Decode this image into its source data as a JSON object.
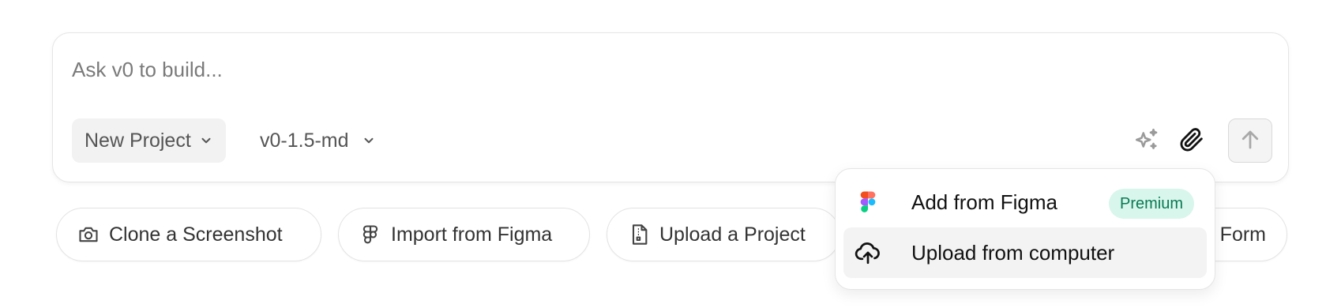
{
  "prompt": {
    "placeholder": "Ask v0 to build...",
    "value": ""
  },
  "toolbar": {
    "project_label": "New Project",
    "model_label": "v0-1.5-md"
  },
  "chips": {
    "clone_label": "Clone a Screenshot",
    "figma_label": "Import from Figma",
    "upload_label": "Upload a Project",
    "form_label": "Form"
  },
  "attach_menu": {
    "items": [
      {
        "label": "Add from Figma",
        "badge": "Premium",
        "icon": "figma-icon"
      },
      {
        "label": "Upload from computer",
        "icon": "cloud-upload-icon"
      }
    ]
  },
  "colors": {
    "premium_bg": "#d8f6ec",
    "premium_text": "#0a7a55",
    "menu_hover": "#f3f3f3",
    "chip_border": "#e3e3e3"
  }
}
